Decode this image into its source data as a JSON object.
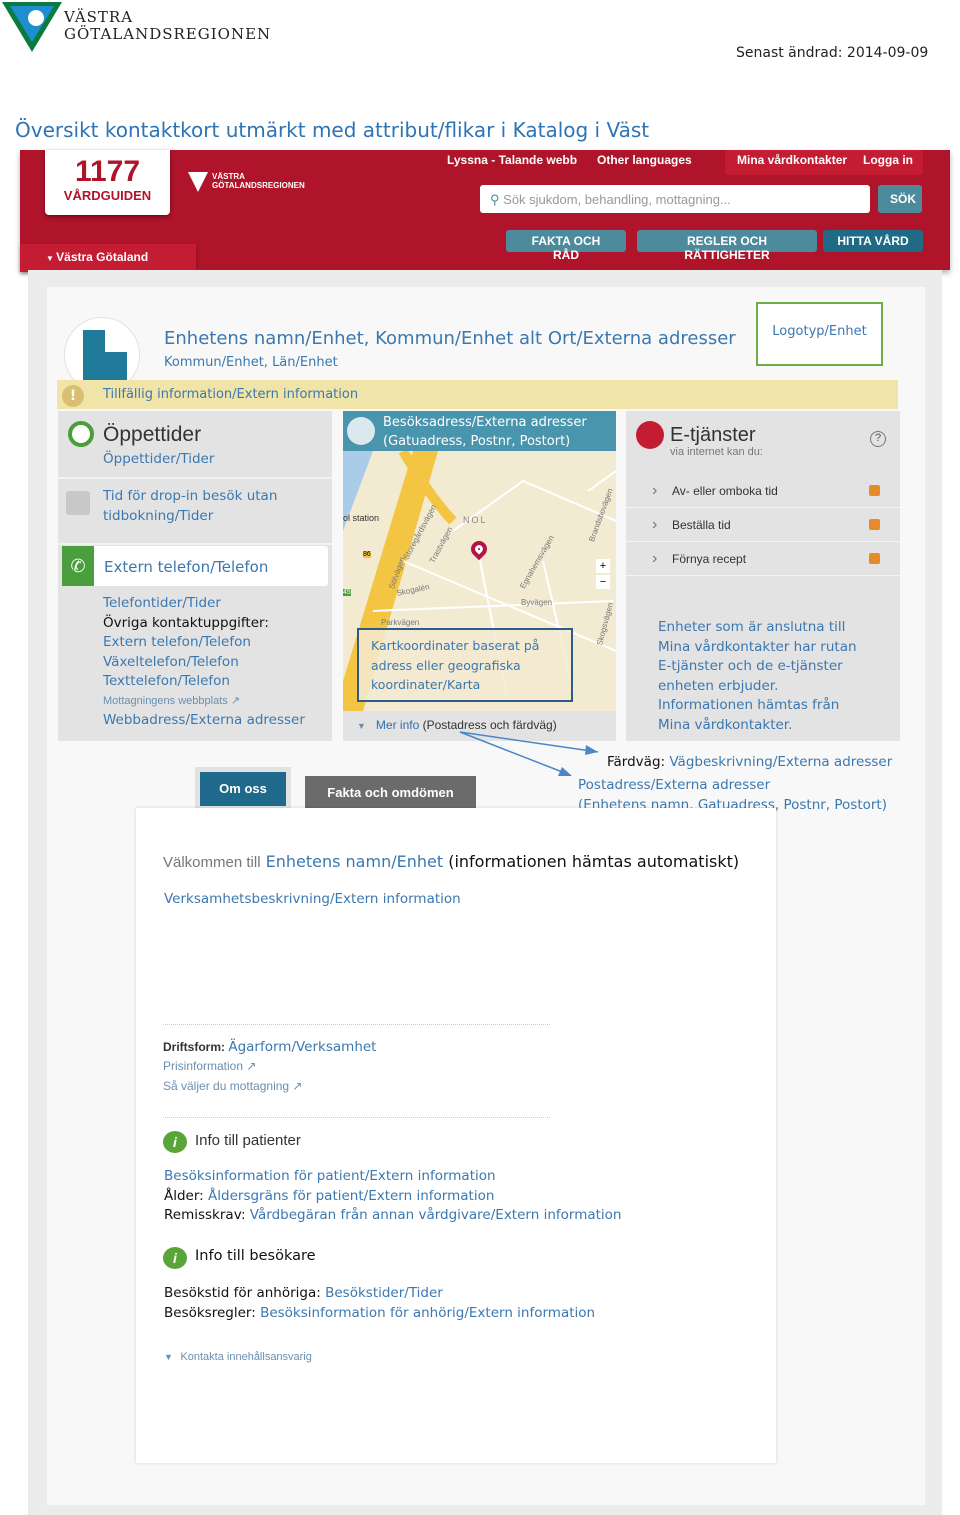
{
  "doc": {
    "org_line1": "VÄSTRA",
    "org_line2": "GÖTALANDSREGIONEN",
    "last_changed": "Senast ändrad: 2014-09-09",
    "title": "Översikt kontaktkort utmärkt med attribut/flikar i Katalog i Väst"
  },
  "site": {
    "logo_line1": "1177",
    "logo_line2": "VÅRDGUIDEN",
    "vgr_line1": "VÄSTRA",
    "vgr_line2": "GÖTALANDSREGIONEN",
    "top_links": [
      "Lyssna - Talande webb",
      "Other languages"
    ],
    "mina": "Mina vårdkontakter",
    "login": "Logga in",
    "search_placeholder": "Sök sjukdom, behandling, mottagning...",
    "search_button": "SÖK",
    "nav": [
      "FAKTA OCH RÅD",
      "REGLER OCH RÄTTIGHETER",
      "HITTA VÅRD"
    ],
    "region": "Västra Götaland",
    "accent": "#b0142a"
  },
  "card": {
    "title": "Enhetens namn/Enhet, Kommun/Enhet alt Ort/Externa adresser",
    "subtitle": "Kommun/Enhet, Län/Enhet",
    "logo_box": "Logotyp/Enhet",
    "notice": "Tillfällig information/Extern information"
  },
  "left": {
    "heading": "Öppettider",
    "hours": "Öppettider/Tider",
    "dropin": "Tid för drop-in besök utan tidbokning/Tider",
    "phone": "Extern telefon/Telefon",
    "phone_hours": "Telefontider/Tider",
    "other_label": "Övriga kontaktuppgifter:",
    "ext": "Extern telefon/Telefon",
    "switch": "Växeltelefon/Telefon",
    "text": "Texttelefon/Telefon",
    "web_label": "Mottagningens webbplats",
    "web": "Webbadress/Externa adresser"
  },
  "map": {
    "header1": "Besöksadress/Externa adresser",
    "header2": "(Gatuadress, Postnr, Postort)",
    "labels": [
      "ol station",
      "NOL",
      "Storegårdsvägen",
      "Trastvägen",
      "Sölvägen",
      "Skogalén",
      "Egnahemsvägen",
      "Byvägen",
      "Parkvägen",
      "Skogsvägen",
      "Brandsbovägen",
      "86",
      "45"
    ],
    "zoom_in": "+",
    "zoom_out": "−",
    "annotation": "Kartkoordinater baserat på adress eller geografiska koordinater/Karta",
    "more": "Mer info",
    "more_paren": "(Postadress och färdväg)"
  },
  "right": {
    "heading": "E-tjänster",
    "sub": "via internet kan du:",
    "help": "?",
    "items": [
      "Av- eller omboka tid",
      "Beställa tid",
      "Förnya recept"
    ],
    "note": "Enheter som är anslutna till Mina vårdkontakter har rutan E-tjänster och de e-tjänster enheten erbjuder. Informationen hämtas från Mina vårdkontakter."
  },
  "route": {
    "label": "Färdväg:",
    "value": "Vägbeskrivning/Externa adresser",
    "postal1": "Postadress/Externa adresser",
    "postal2": "(Enhetens namn, Gatuadress, Postnr, Postort)"
  },
  "tabs": [
    "Om oss",
    "Fakta och omdömen"
  ],
  "content": {
    "welcome": "Välkommen till",
    "unit": "Enhetens namn/Enhet",
    "auto": "(informationen hämtas automatiskt)",
    "desc": "Verksamhetsbeskrivning/Extern information",
    "drift_label": "Driftsform:",
    "drift": "Ägarform/Verksamhet",
    "price": "Prisinformation",
    "choose": "Så väljer du mottagning",
    "pat_heading": "Info till patienter",
    "pat1": "Besöksinformation för patient/Extern information",
    "age_label": "Ålder:",
    "age": "Åldersgräns för patient/Extern information",
    "ref_label": "Remisskrav:",
    "ref": "Vårdbegäran från annan vårdgivare/Extern information",
    "vis_heading": "Info till besökare",
    "vt_label": "Besökstid för anhöriga:",
    "vt": "Besökstider/Tider",
    "vr_label": "Besöksregler:",
    "vr": "Besöksinformation för anhörig/Extern information",
    "contact": "Kontakta innehållsansvarig"
  }
}
